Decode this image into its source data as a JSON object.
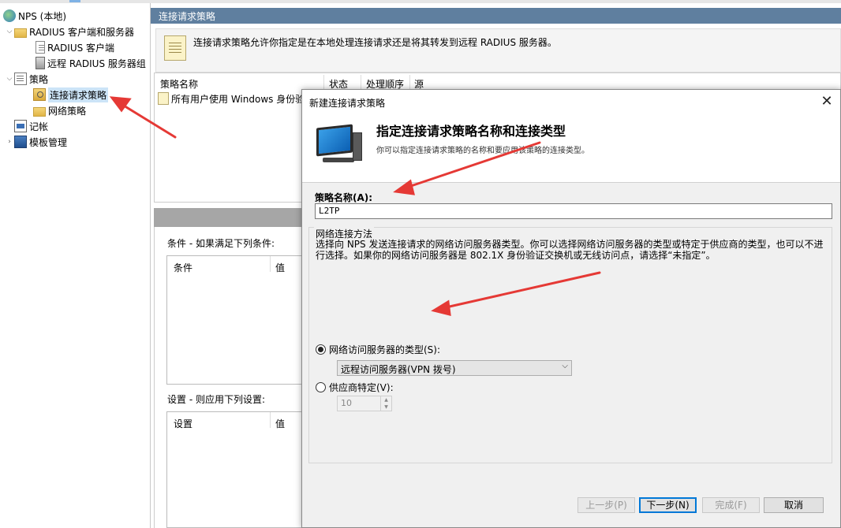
{
  "tree": {
    "root": "NPS (本地)",
    "radius_group": "RADIUS 客户端和服务器",
    "radius_clients": "RADIUS 客户端",
    "remote_groups": "远程 RADIUS 服务器组",
    "policies": "策略",
    "conn_req_policies": "连接请求策略",
    "network_policies": "网络策略",
    "accounting": "记帐",
    "templates": "模板管理"
  },
  "main": {
    "title": "连接请求策略",
    "description": "连接请求策略允许你指定是在本地处理连接请求还是将其转发到远程 RADIUS 服务器。",
    "columns": [
      "策略名称",
      "状态",
      "处理顺序",
      "源"
    ],
    "rows": [
      {
        "name": "所有用户使用 Windows 身份验证"
      }
    ],
    "conditions_label": "条件 - 如果满足下列条件:",
    "conditions_columns": [
      "条件",
      "值"
    ],
    "settings_label": "设置 - 则应用下列设置:",
    "settings_columns": [
      "设置",
      "值"
    ]
  },
  "dialog": {
    "title": "新建连接请求策略",
    "heading": "指定连接请求策略名称和连接类型",
    "subheading": "你可以指定连接请求策略的名称和要应用该策略的连接类型。",
    "name_label": "策略名称(A):",
    "name_value": "L2TP",
    "group_title": "网络连接方法",
    "group_desc": "选择向 NPS 发送连接请求的网络访问服务器类型。你可以选择网络访问服务器的类型或特定于供应商的类型，也可以不进行选择。如果你的网络访问服务器是 802.1X 身份验证交换机或无线访问点，请选择“未指定”。",
    "radio_type_label": "网络访问服务器的类型(S):",
    "radio_type_checked": true,
    "server_type_value": "远程访问服务器(VPN 拨号)",
    "radio_vendor_label": "供应商特定(V):",
    "radio_vendor_checked": false,
    "vendor_value": "10",
    "buttons": {
      "back": "上一步(P)",
      "next": "下一步(N)",
      "finish": "完成(F)",
      "cancel": "取消"
    }
  },
  "colors": {
    "title_bar": "#5f7f9f",
    "selection": "#cce4f7",
    "annotation_arrow": "#e53935",
    "primary_border": "#0078d7"
  },
  "icons": {
    "root": "nps-globe-icon",
    "folder": "folder-icon",
    "client": "document-icon",
    "server_group": "server-icon",
    "policy": "policy-icon",
    "accounting": "log-icon",
    "templates": "template-icon",
    "dialog_header": "computer-monitor-icon"
  }
}
